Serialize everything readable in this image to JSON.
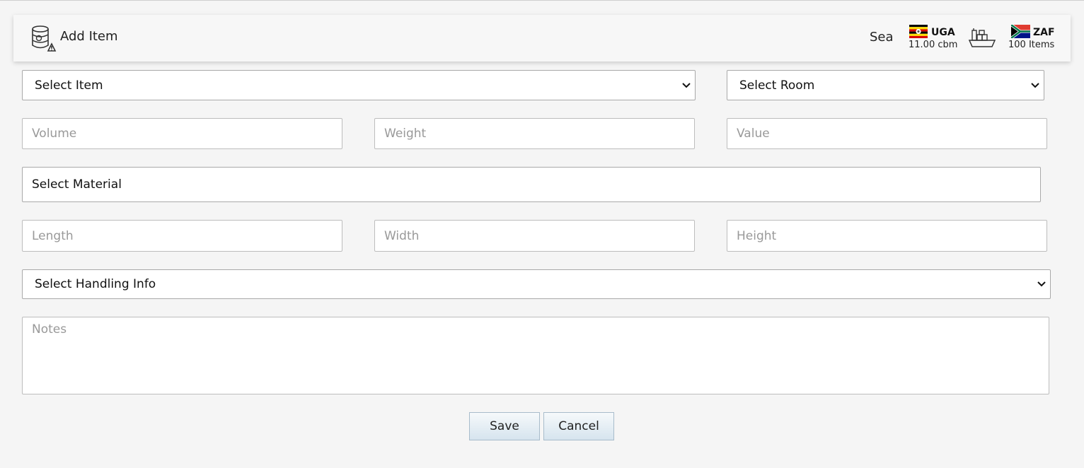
{
  "header": {
    "title": "Add Item",
    "mode": "Sea",
    "origin": {
      "code": "UGA",
      "volume": "11.00 cbm"
    },
    "destination": {
      "code": "ZAF",
      "items": "100 Items"
    }
  },
  "form": {
    "item_select": "Select Item",
    "room_select": "Select Room",
    "volume_placeholder": "Volume",
    "weight_placeholder": "Weight",
    "value_placeholder": "Value",
    "material_select": "Select Material",
    "length_placeholder": "Length",
    "width_placeholder": "Width",
    "height_placeholder": "Height",
    "handling_select": "Select Handling Info",
    "notes_placeholder": "Notes"
  },
  "actions": {
    "save_label": "Save",
    "cancel_label": "Cancel"
  },
  "colors": {
    "background": "#f5f5f5",
    "header_bg": "#f7f7f7",
    "button_gradient_top": "#f6f9fb",
    "button_gradient_bottom": "#d6e4ee"
  }
}
